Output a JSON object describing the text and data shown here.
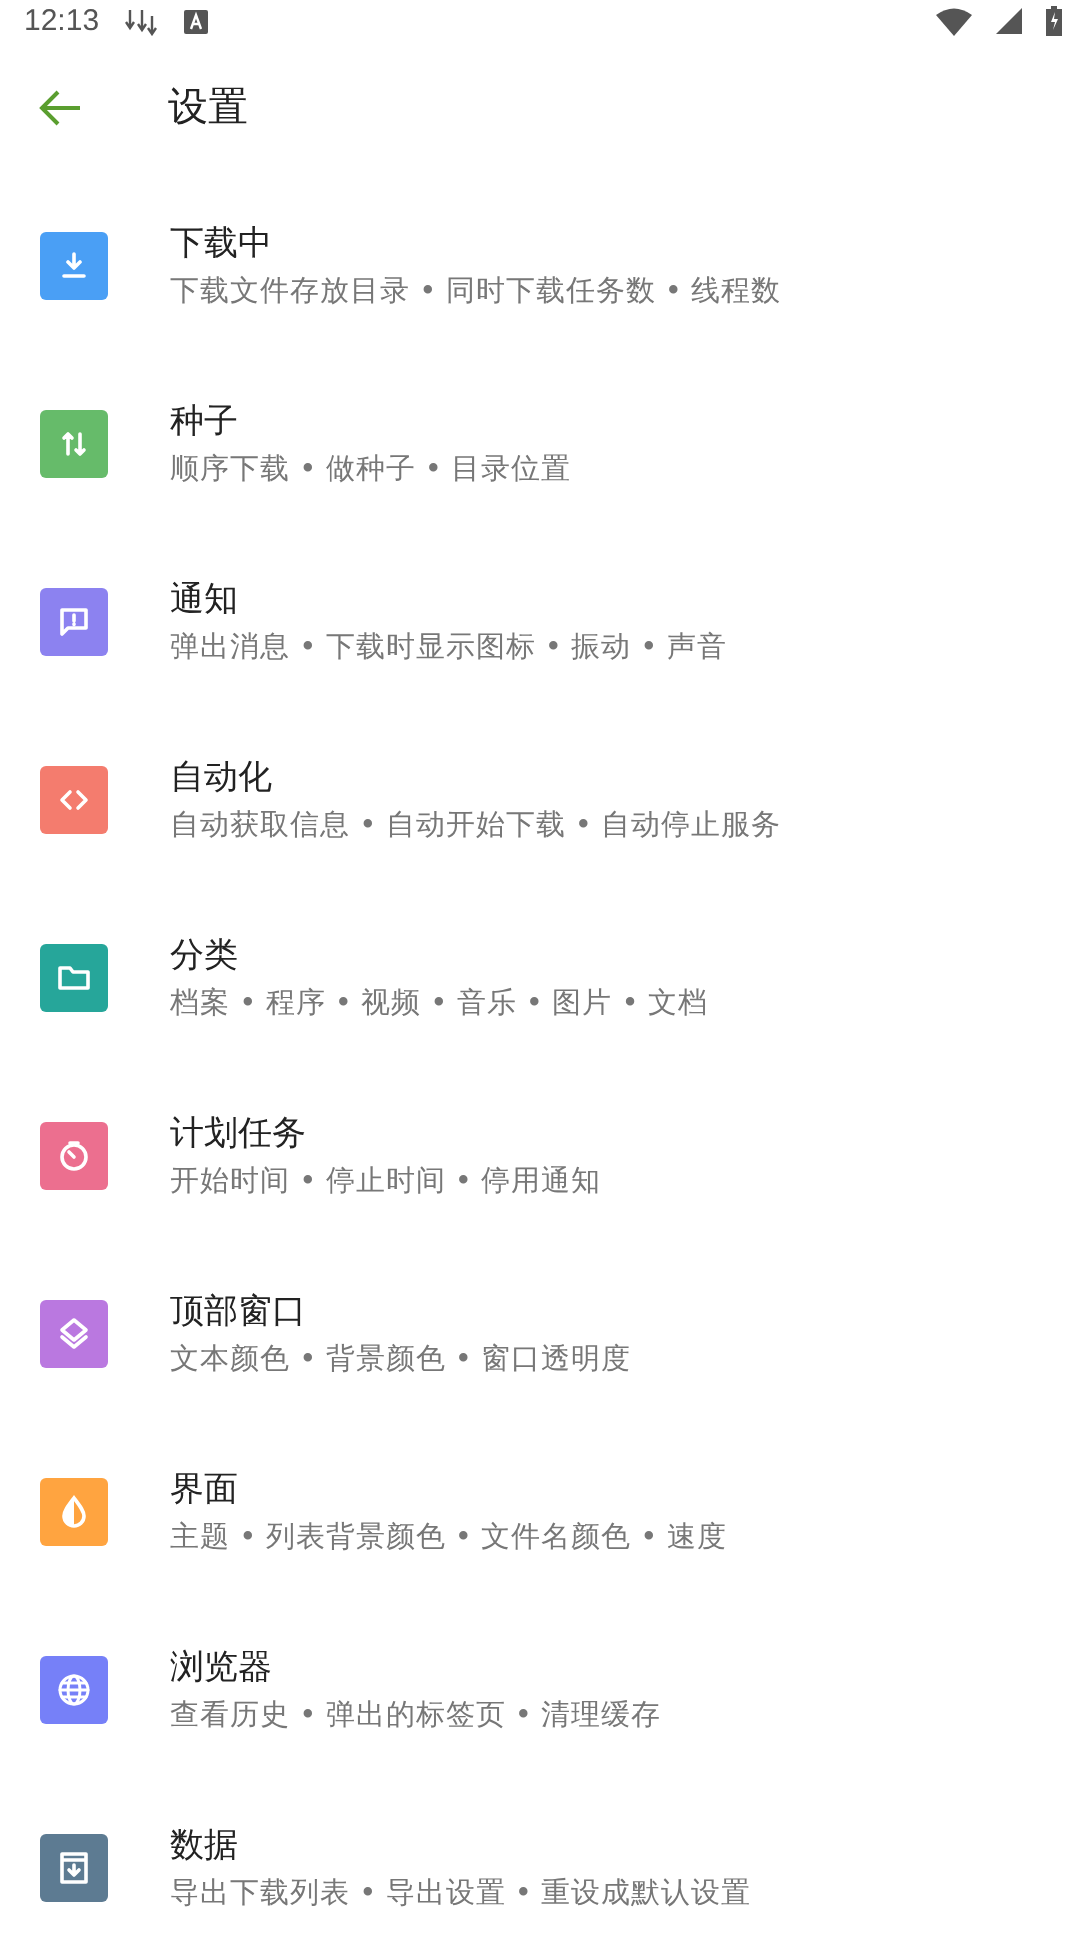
{
  "status_bar": {
    "time": "12:13"
  },
  "toolbar": {
    "title": "设置"
  },
  "items": [
    {
      "kind": "download",
      "color": "#4a9ff5",
      "title": "下载中",
      "summary": "下载文件存放目录 • 同时下载任务数 • 线程数"
    },
    {
      "kind": "seed",
      "color": "#66bb6a",
      "title": "种子",
      "summary": "顺序下载 • 做种子 • 目录位置"
    },
    {
      "kind": "notify",
      "color": "#8c82f0",
      "title": "通知",
      "summary": "弹出消息 • 下载时显示图标 • 振动 • 声音"
    },
    {
      "kind": "code",
      "color": "#f47c6e",
      "title": "自动化",
      "summary": "自动获取信息 • 自动开始下载 • 自动停止服务"
    },
    {
      "kind": "folder",
      "color": "#26a69a",
      "title": "分类",
      "summary": "档案 • 程序 • 视频 • 音乐 • 图片 • 文档"
    },
    {
      "kind": "timer",
      "color": "#ec6f8f",
      "title": "计划任务",
      "summary": "开始时间 • 停止时间 • 停用通知"
    },
    {
      "kind": "layers",
      "color": "#ba78e0",
      "title": "顶部窗口",
      "summary": "文本颜色 • 背景颜色 • 窗口透明度"
    },
    {
      "kind": "drop",
      "color": "#ffa440",
      "title": "界面",
      "summary": "主题 • 列表背景颜色 • 文件名颜色 • 速度"
    },
    {
      "kind": "globe",
      "color": "#7680f8",
      "title": "浏览器",
      "summary": "查看历史 • 弹出的标签页 • 清理缓存"
    },
    {
      "kind": "archive",
      "color": "#5d7b92",
      "title": "数据",
      "summary": "导出下载列表 • 导出设置 • 重设成默认设置"
    }
  ]
}
